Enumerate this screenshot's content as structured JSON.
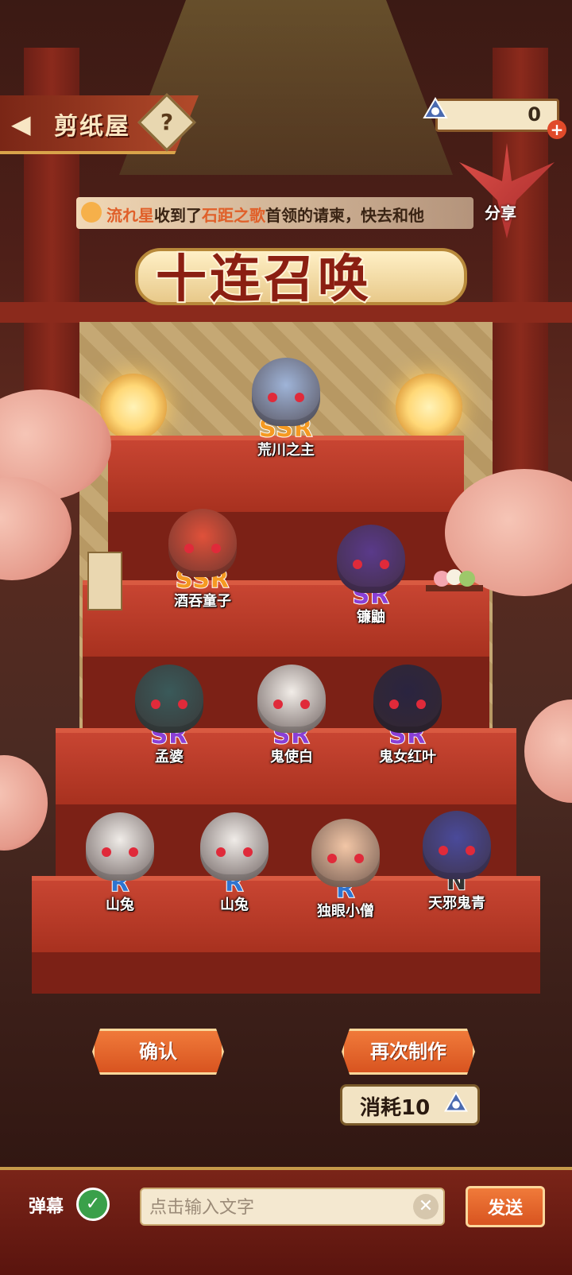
{
  "header": {
    "title": "剪纸屋",
    "help_label": "?",
    "back_icon": "back-arrow-icon"
  },
  "currency": {
    "value": "0",
    "plus": "+",
    "icon": "ticket-icon"
  },
  "banner": {
    "player": "流れ星",
    "text1": "收到了",
    "guild": "石距之歌",
    "text2": "首领的请柬，快去和他",
    "share": "分享"
  },
  "summon_title": "十连召唤",
  "characters": [
    {
      "rarity": "SSR",
      "name": "荒川之主"
    },
    {
      "rarity": "SSR",
      "name": "酒吞童子"
    },
    {
      "rarity": "SR",
      "name": "镰鼬"
    },
    {
      "rarity": "SR",
      "name": "孟婆"
    },
    {
      "rarity": "SR",
      "name": "鬼使白"
    },
    {
      "rarity": "SR",
      "name": "鬼女红叶"
    },
    {
      "rarity": "R",
      "name": "山兔"
    },
    {
      "rarity": "R",
      "name": "山兔"
    },
    {
      "rarity": "R",
      "name": "独眼小僧"
    },
    {
      "rarity": "N",
      "name": "天邪鬼青"
    }
  ],
  "actions": {
    "confirm": "确认",
    "again": "再次制作",
    "cost": "消耗10"
  },
  "chat": {
    "danmu_label": "弹幕",
    "placeholder": "点击输入文字",
    "clear": "✕",
    "send": "发送"
  },
  "colors": {
    "ssr": "#f59a22",
    "sr": "#8a3fd6",
    "r": "#2f74d0",
    "n": "#333333",
    "button": "#e06428"
  }
}
